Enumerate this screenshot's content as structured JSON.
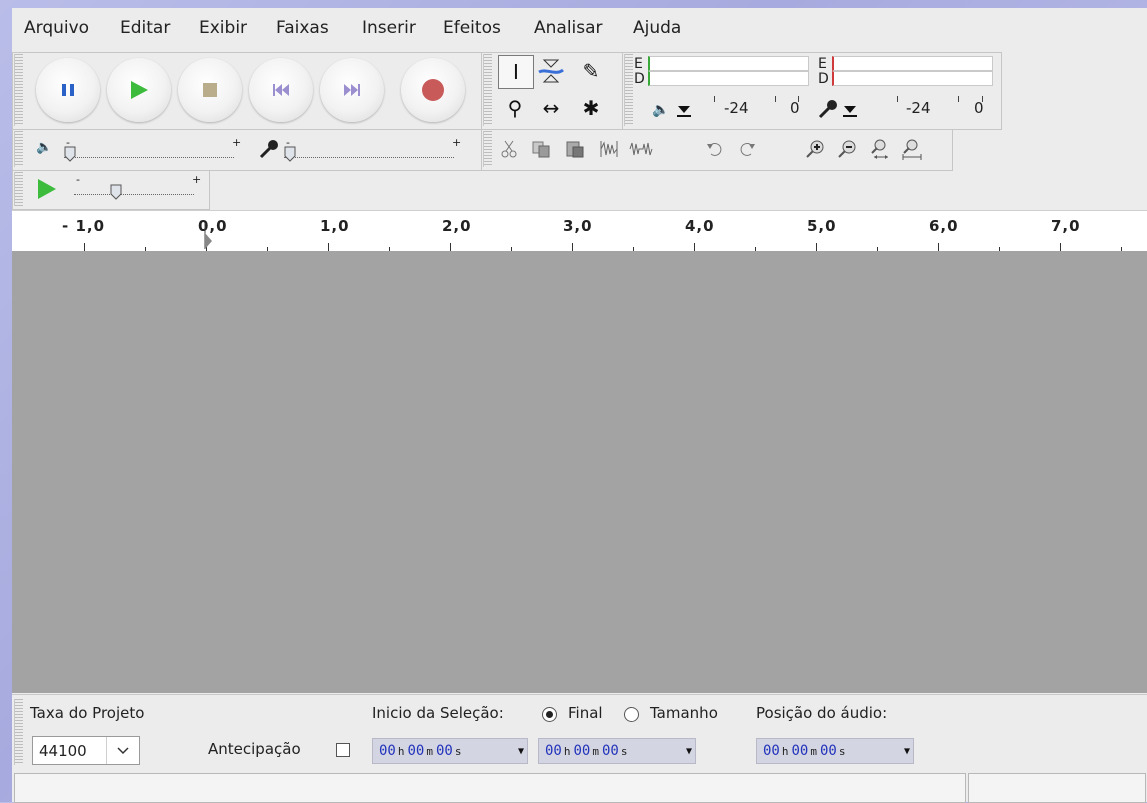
{
  "menu": [
    "Arquivo",
    "Editar",
    "Exibir",
    "Faixas",
    "Inserir",
    "Efeitos",
    "Analisar",
    "Ajuda"
  ],
  "transport": {
    "buttons": [
      {
        "name": "pause-button",
        "icon": "pause-icon"
      },
      {
        "name": "play-button",
        "icon": "play-icon"
      },
      {
        "name": "stop-button",
        "icon": "stop-icon"
      },
      {
        "name": "skip-to-start-button",
        "icon": "skip-start-icon"
      },
      {
        "name": "skip-to-end-button",
        "icon": "skip-end-icon"
      },
      {
        "name": "record-button",
        "icon": "record-icon"
      }
    ]
  },
  "tools": [
    "I",
    "⇜",
    "✎",
    "⚲",
    "↔",
    "✱"
  ],
  "meters": {
    "left_channel": "E",
    "right_channel": "D",
    "scale_a": [
      "-24",
      "0"
    ],
    "scale_b": [
      "-24",
      "0"
    ]
  },
  "mixer": {
    "plus": "+",
    "minus": "-"
  },
  "ruler": [
    "- 1,0",
    "0,0",
    "1,0",
    "2,0",
    "3,0",
    "4,0",
    "5,0",
    "6,0",
    "7,0"
  ],
  "selection": {
    "rate_label": "Taxa do Projeto",
    "rate_value": "44100",
    "snap_label": "Antecipação",
    "start_label": "Inicio da Seleção:",
    "end_option": "Final",
    "length_option": "Tamanho",
    "position_label": "Posição do áudio:",
    "time": {
      "h": "00",
      "m": "00",
      "s": "00",
      "hu": "h",
      "mu": "m",
      "su": "s"
    }
  },
  "colors": {
    "accent_play": "#3dbb3d",
    "record": "#c85a5a",
    "pause": "#2a62c8",
    "track_bg": "#a3a3a3",
    "time_digits": "#2233bb"
  }
}
